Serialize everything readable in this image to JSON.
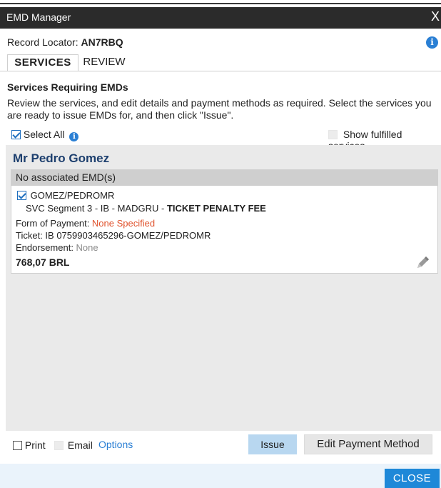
{
  "window": {
    "title": "EMD Manager",
    "close_glyph": "X"
  },
  "record": {
    "label": "Record Locator: ",
    "value": "AN7RBQ"
  },
  "tabs": [
    {
      "label": "SERVICES"
    },
    {
      "label": "REVIEW"
    }
  ],
  "section": {
    "title": "Services Requiring EMDs",
    "description": "Review the services, and edit details and payment methods as required. Select the services you are ready to issue EMDs for, and then click \"Issue\"."
  },
  "select_all": {
    "label": "Select All",
    "checked": true
  },
  "show_fulfilled": {
    "label": "Show fulfilled services",
    "checked": false
  },
  "passenger": {
    "name": "Mr Pedro Gomez",
    "emd_status": "No associated EMD(s)",
    "service": {
      "checked": true,
      "pax_code": "GOMEZ/PEDROMR",
      "segment_text": "SVC Segment  3  - IB  -  MADGRU  - ",
      "service_name": "TICKET PENALTY FEE",
      "fop_label": "Form of Payment: ",
      "fop_value": "None Specified",
      "ticket_label": "Ticket: ",
      "ticket_value": "IB 0759903465296-GOMEZ/PEDROMR",
      "endorsement_label": "Endorsement: ",
      "endorsement_value": "None",
      "amount": "768,07 BRL"
    }
  },
  "footer": {
    "print_label": "Print",
    "email_label": "Email",
    "options_label": "Options",
    "issue_label": "Issue",
    "edit_payment_label": "Edit Payment Method"
  },
  "close_button": {
    "label": "CLOSE"
  },
  "icons": {
    "info": "info-icon",
    "edit": "pencil-icon"
  },
  "colors": {
    "title_bar": "#2b2b2b",
    "accent": "#1e88d8",
    "passenger_name": "#1d3f6e",
    "warning": "#e0522c"
  }
}
